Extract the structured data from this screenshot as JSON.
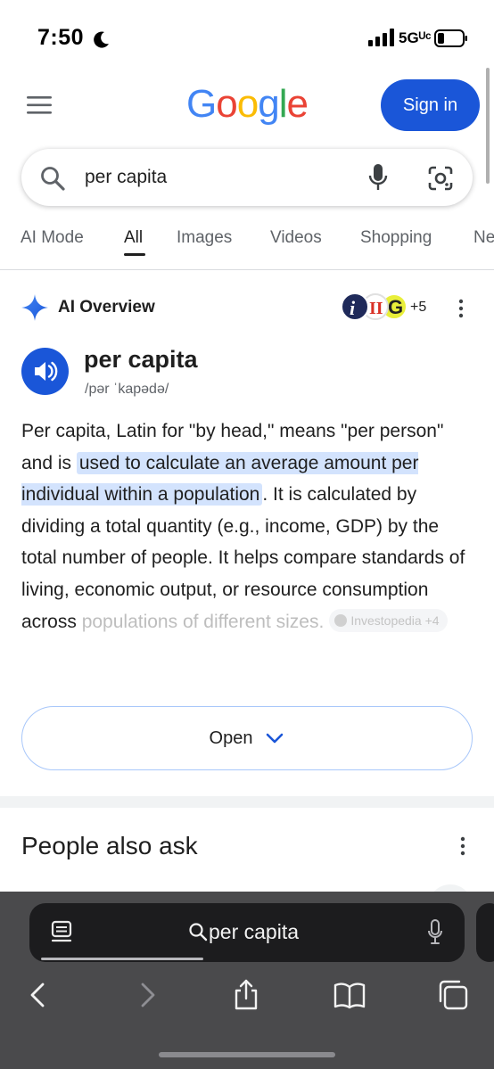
{
  "status_bar": {
    "time": "7:50",
    "network": "5Gᵁᶜ"
  },
  "header": {
    "logo_letters": [
      {
        "ch": "G",
        "color": "#4285F4"
      },
      {
        "ch": "o",
        "color": "#EA4335"
      },
      {
        "ch": "o",
        "color": "#FBBC05"
      },
      {
        "ch": "g",
        "color": "#4285F4"
      },
      {
        "ch": "l",
        "color": "#34A853"
      },
      {
        "ch": "e",
        "color": "#EA4335"
      }
    ],
    "sign_in_label": "Sign in"
  },
  "search": {
    "query": "per capita"
  },
  "tabs": [
    {
      "label": "AI Mode",
      "active": false
    },
    {
      "label": "All",
      "active": true
    },
    {
      "label": "Images",
      "active": false
    },
    {
      "label": "Videos",
      "active": false
    },
    {
      "label": "Shopping",
      "active": false
    },
    {
      "label": "Ne",
      "active": false
    }
  ],
  "ai_overview": {
    "title": "AI Overview",
    "sources_more": "+5",
    "word": "per capita",
    "phonetic": "/pər ˈkapədə/",
    "para_1": "Per capita, Latin for \"by head,\" means \"per person\" and is ",
    "para_highlight": "used to calculate an average amount per individual within a population",
    "para_2": ". It is calculated by dividing a total quantity (e.g., income, GDP) by the total number of people. It helps compare standards of living, economic output, or resource consumption across ",
    "para_faded": "populations of different sizes.",
    "source_chip": "Investopedia +4",
    "open_label": "Open"
  },
  "people_also_ask": {
    "title": "People also ask"
  },
  "safari": {
    "address_text": "per capita"
  },
  "colors": {
    "accent_blue": "#1a56d8",
    "highlight": "#d3e3fd"
  }
}
